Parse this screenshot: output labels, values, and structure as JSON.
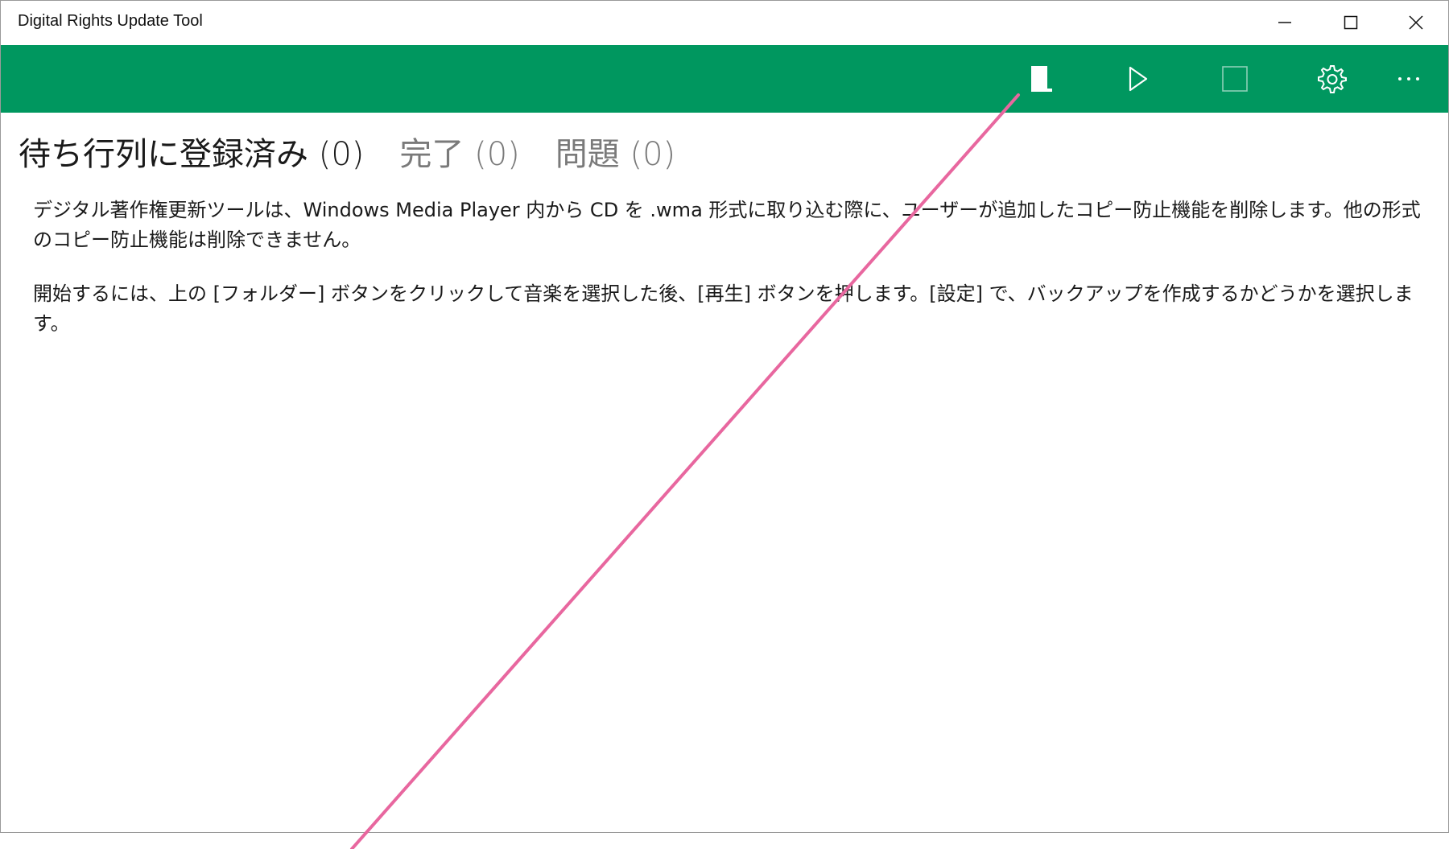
{
  "window": {
    "title": "Digital Rights Update Tool"
  },
  "command_bar": {
    "buttons": [
      {
        "name": "folder",
        "icon": "folder-icon"
      },
      {
        "name": "play",
        "icon": "play-icon"
      },
      {
        "name": "stop",
        "icon": "stop-icon"
      },
      {
        "name": "settings",
        "icon": "gear-icon"
      },
      {
        "name": "more",
        "icon": "more-icon"
      }
    ],
    "background_color": "#00975f"
  },
  "tabs": [
    {
      "label": "待ち行列に登録済み (0)",
      "active": true
    },
    {
      "label": "完了 (0)",
      "active": false
    },
    {
      "label": "問題 (0)",
      "active": false
    }
  ],
  "content": {
    "paragraph1": "デジタル著作権更新ツールは、Windows Media Player 内から CD を .wma 形式に取り込む際に、ユーザーが追加したコピー防止機能を削除します。他の形式のコピー防止機能は削除できません。",
    "paragraph2": "開始するには、上の [フォルダー] ボタンをクリックして音楽を選択した後、[再生] ボタンを押します。[設定] で、バックアップを作成するかどうかを選択します。"
  },
  "annotation": {
    "color": "#e8679f"
  }
}
